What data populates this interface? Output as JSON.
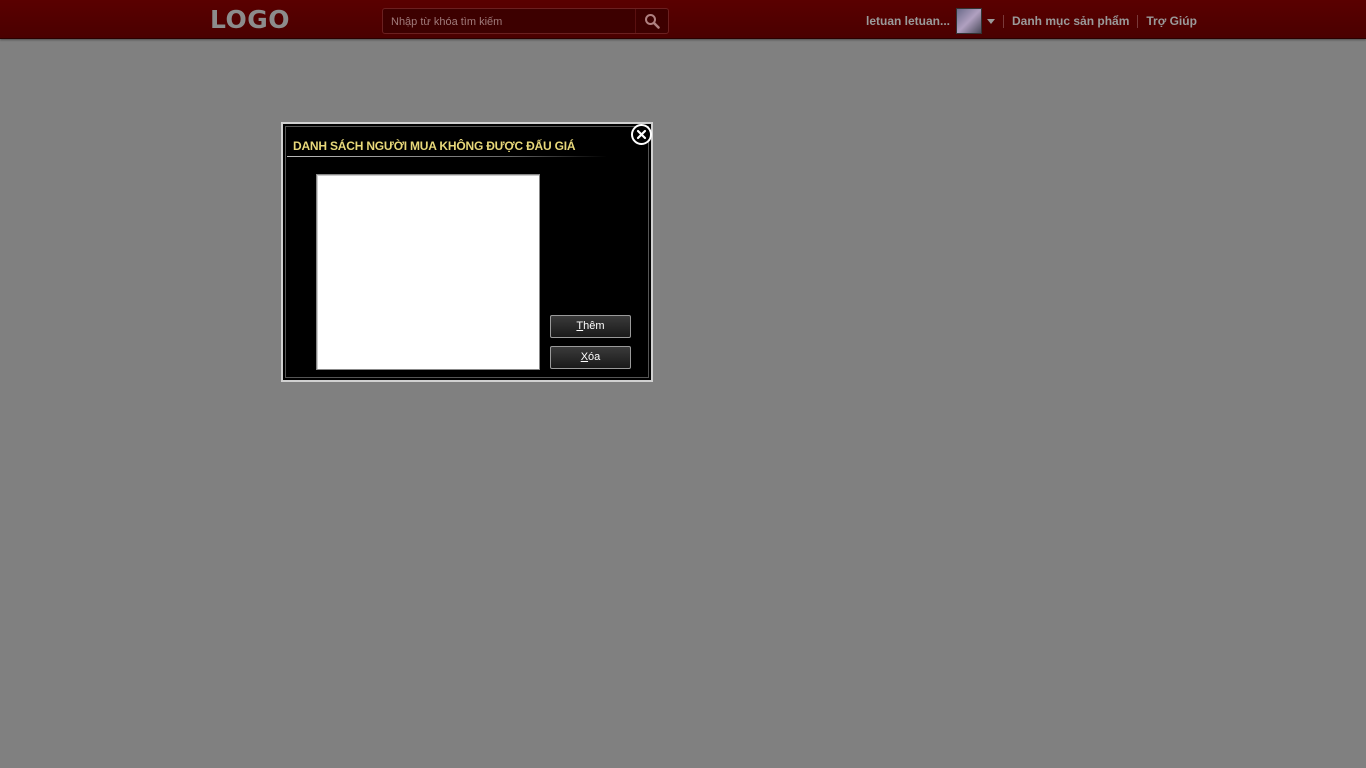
{
  "header": {
    "logo": "LOGO",
    "search": {
      "placeholder": "Nhập từ khóa tìm kiếm"
    },
    "user_name": "letuan letuan...",
    "nav": {
      "categories": "Danh mục sản phẩm",
      "help": "Trợ Giúp"
    }
  },
  "dialog": {
    "title": "DANH SÁCH NGƯỜI MUA KHÔNG ĐƯỢC ĐẤU GIÁ",
    "add_button": {
      "mnemonic": "T",
      "rest": "hêm"
    },
    "delete_button": {
      "mnemonic": "X",
      "rest": "óa"
    }
  },
  "colors": {
    "topbar": "#4f0000",
    "background": "#808080",
    "dialog_title": "#e8d87a"
  },
  "icons": {
    "search": "search-icon",
    "close": "close-icon",
    "dropdown": "chevron-down-icon"
  }
}
